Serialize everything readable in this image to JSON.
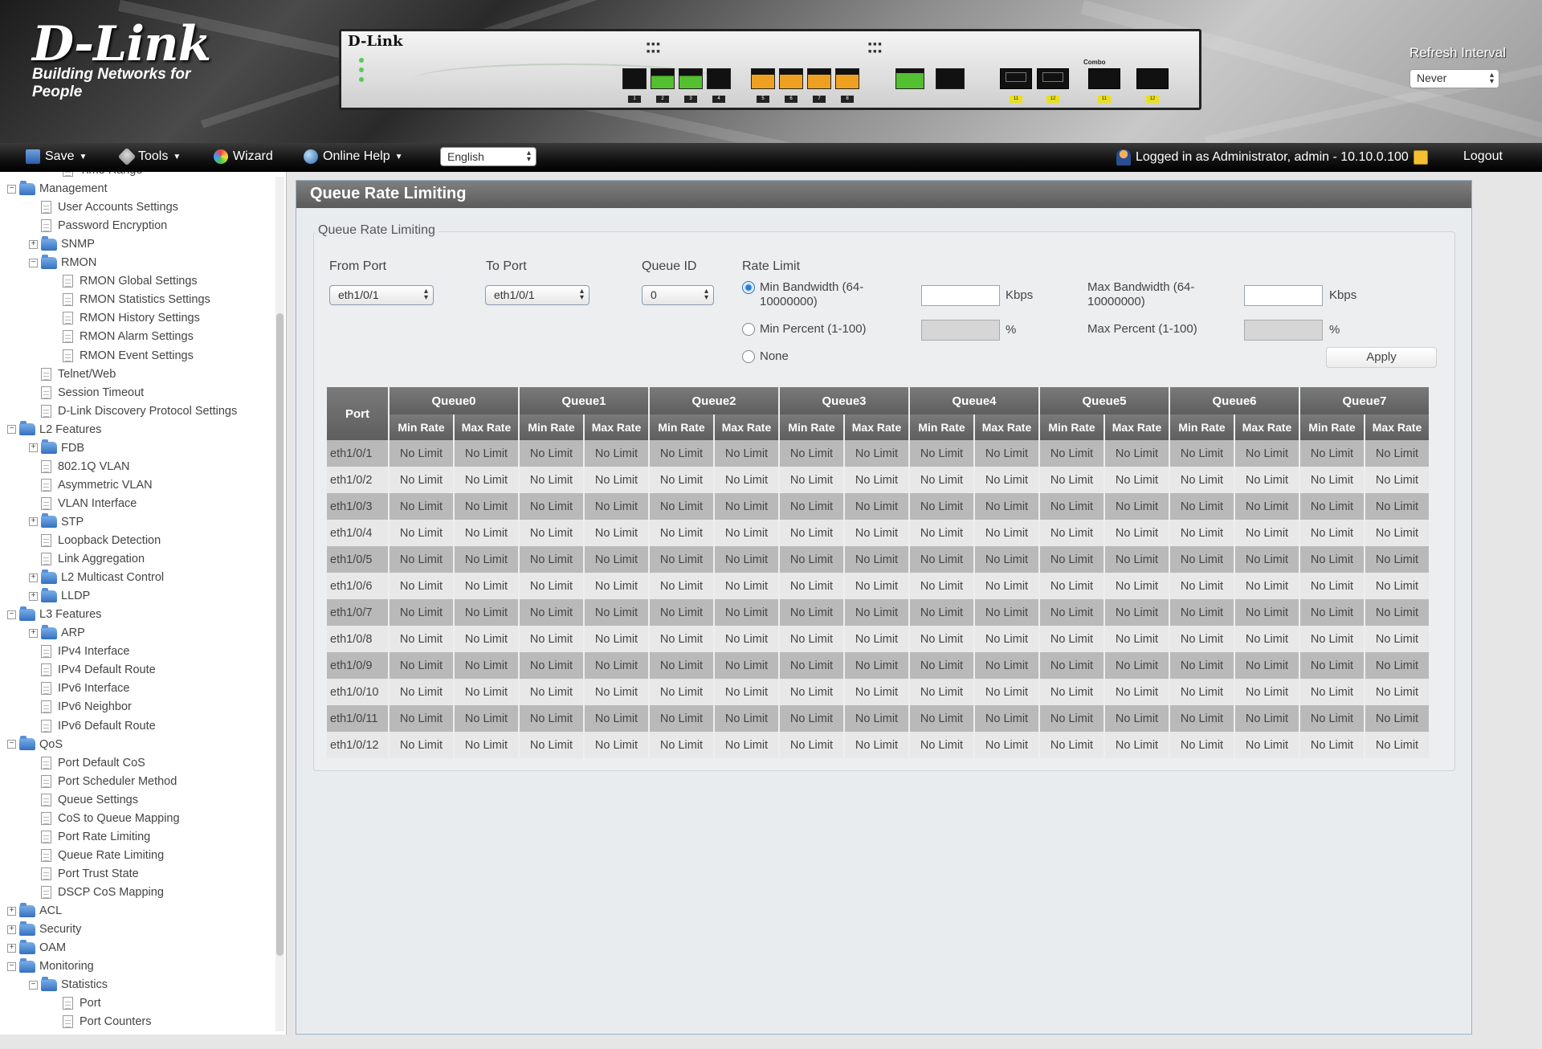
{
  "header": {
    "logo_main": "D-Link",
    "logo_sub": "Building Networks for People",
    "device": {
      "brand": "D-Link",
      "ports_left": [
        "1",
        "2",
        "3",
        "4"
      ],
      "ports_mid": [
        "5",
        "6",
        "7",
        "8"
      ],
      "ports_combo": [
        "11",
        "12",
        "11",
        "12"
      ],
      "combo_label": "Combo"
    },
    "refresh_label": "Refresh Interval",
    "refresh_value": "Never"
  },
  "menubar": {
    "save": "Save",
    "tools": "Tools",
    "wizard": "Wizard",
    "online_help": "Online Help",
    "language": "English",
    "login_info": "Logged in as Administrator, admin - 10.10.0.100",
    "logout": "Logout"
  },
  "sidebar": {
    "items": [
      {
        "label": "Time Range",
        "level": 2,
        "type": "page",
        "toggle": ""
      },
      {
        "label": "Management",
        "level": 0,
        "type": "folder",
        "toggle": "−"
      },
      {
        "label": "User Accounts Settings",
        "level": 1,
        "type": "page",
        "toggle": ""
      },
      {
        "label": "Password Encryption",
        "level": 1,
        "type": "page",
        "toggle": ""
      },
      {
        "label": "SNMP",
        "level": 1,
        "type": "folder",
        "toggle": "+"
      },
      {
        "label": "RMON",
        "level": 1,
        "type": "folder",
        "toggle": "−"
      },
      {
        "label": "RMON Global Settings",
        "level": 2,
        "type": "page",
        "toggle": ""
      },
      {
        "label": "RMON Statistics Settings",
        "level": 2,
        "type": "page",
        "toggle": ""
      },
      {
        "label": "RMON History Settings",
        "level": 2,
        "type": "page",
        "toggle": ""
      },
      {
        "label": "RMON Alarm Settings",
        "level": 2,
        "type": "page",
        "toggle": ""
      },
      {
        "label": "RMON Event Settings",
        "level": 2,
        "type": "page",
        "toggle": ""
      },
      {
        "label": "Telnet/Web",
        "level": 1,
        "type": "page",
        "toggle": ""
      },
      {
        "label": "Session Timeout",
        "level": 1,
        "type": "page",
        "toggle": ""
      },
      {
        "label": "D-Link Discovery Protocol Settings",
        "level": 1,
        "type": "page",
        "toggle": ""
      },
      {
        "label": "L2 Features",
        "level": 0,
        "type": "folder",
        "toggle": "−"
      },
      {
        "label": "FDB",
        "level": 1,
        "type": "folder",
        "toggle": "+"
      },
      {
        "label": "802.1Q VLAN",
        "level": 1,
        "type": "page",
        "toggle": ""
      },
      {
        "label": "Asymmetric VLAN",
        "level": 1,
        "type": "page",
        "toggle": ""
      },
      {
        "label": "VLAN Interface",
        "level": 1,
        "type": "page",
        "toggle": ""
      },
      {
        "label": "STP",
        "level": 1,
        "type": "folder",
        "toggle": "+"
      },
      {
        "label": "Loopback Detection",
        "level": 1,
        "type": "page",
        "toggle": ""
      },
      {
        "label": "Link Aggregation",
        "level": 1,
        "type": "page",
        "toggle": ""
      },
      {
        "label": "L2 Multicast Control",
        "level": 1,
        "type": "folder",
        "toggle": "+"
      },
      {
        "label": "LLDP",
        "level": 1,
        "type": "folder",
        "toggle": "+"
      },
      {
        "label": "L3 Features",
        "level": 0,
        "type": "folder",
        "toggle": "−"
      },
      {
        "label": "ARP",
        "level": 1,
        "type": "folder",
        "toggle": "+"
      },
      {
        "label": "IPv4 Interface",
        "level": 1,
        "type": "page",
        "toggle": ""
      },
      {
        "label": "IPv4 Default Route",
        "level": 1,
        "type": "page",
        "toggle": ""
      },
      {
        "label": "IPv6 Interface",
        "level": 1,
        "type": "page",
        "toggle": ""
      },
      {
        "label": "IPv6 Neighbor",
        "level": 1,
        "type": "page",
        "toggle": ""
      },
      {
        "label": "IPv6 Default Route",
        "level": 1,
        "type": "page",
        "toggle": ""
      },
      {
        "label": "QoS",
        "level": 0,
        "type": "folder",
        "toggle": "−"
      },
      {
        "label": "Port Default CoS",
        "level": 1,
        "type": "page",
        "toggle": ""
      },
      {
        "label": "Port Scheduler Method",
        "level": 1,
        "type": "page",
        "toggle": ""
      },
      {
        "label": "Queue Settings",
        "level": 1,
        "type": "page",
        "toggle": ""
      },
      {
        "label": "CoS to Queue Mapping",
        "level": 1,
        "type": "page",
        "toggle": ""
      },
      {
        "label": "Port Rate Limiting",
        "level": 1,
        "type": "page",
        "toggle": ""
      },
      {
        "label": "Queue Rate Limiting",
        "level": 1,
        "type": "page",
        "toggle": ""
      },
      {
        "label": "Port Trust State",
        "level": 1,
        "type": "page",
        "toggle": ""
      },
      {
        "label": "DSCP CoS Mapping",
        "level": 1,
        "type": "page",
        "toggle": ""
      },
      {
        "label": "ACL",
        "level": 0,
        "type": "folder",
        "toggle": "+"
      },
      {
        "label": "Security",
        "level": 0,
        "type": "folder",
        "toggle": "+"
      },
      {
        "label": "OAM",
        "level": 0,
        "type": "folder",
        "toggle": "+"
      },
      {
        "label": "Monitoring",
        "level": 0,
        "type": "folder",
        "toggle": "−"
      },
      {
        "label": "Statistics",
        "level": 1,
        "type": "folder",
        "toggle": "−"
      },
      {
        "label": "Port",
        "level": 2,
        "type": "page",
        "toggle": ""
      },
      {
        "label": "Port Counters",
        "level": 2,
        "type": "page",
        "toggle": ""
      }
    ]
  },
  "content": {
    "title": "Queue Rate Limiting",
    "legend": "Queue Rate Limiting",
    "form": {
      "from_port_label": "From Port",
      "from_port_value": "eth1/0/1",
      "to_port_label": "To Port",
      "to_port_value": "eth1/0/1",
      "queue_id_label": "Queue ID",
      "queue_id_value": "0",
      "rate_limit_label": "Rate Limit",
      "min_bandwidth_label": "Min Bandwidth (64-10000000)",
      "min_percent_label": "Min Percent (1-100)",
      "none_label": "None",
      "max_bandwidth_label": "Max Bandwidth (64-10000000)",
      "max_percent_label": "Max Percent (1-100)",
      "kbps": "Kbps",
      "percent": "%",
      "apply": "Apply"
    },
    "table": {
      "port_header": "Port",
      "queues": [
        "Queue0",
        "Queue1",
        "Queue2",
        "Queue3",
        "Queue4",
        "Queue5",
        "Queue6",
        "Queue7"
      ],
      "min_rate": "Min Rate",
      "max_rate": "Max Rate",
      "no_limit": "No Limit",
      "ports": [
        "eth1/0/1",
        "eth1/0/2",
        "eth1/0/3",
        "eth1/0/4",
        "eth1/0/5",
        "eth1/0/6",
        "eth1/0/7",
        "eth1/0/8",
        "eth1/0/9",
        "eth1/0/10",
        "eth1/0/11",
        "eth1/0/12"
      ]
    }
  }
}
